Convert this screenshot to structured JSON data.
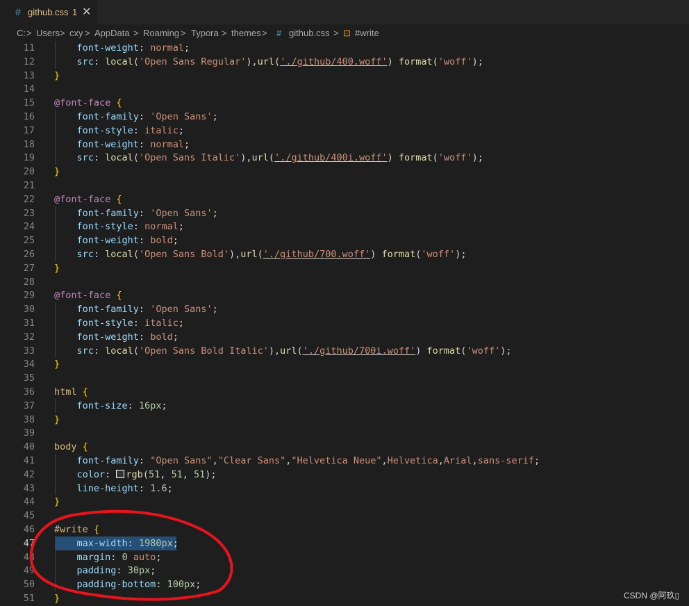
{
  "tab": {
    "hash": "#",
    "name": "github.css",
    "badge": "1",
    "close": "✕"
  },
  "breadcrumb": [
    "C:",
    ">",
    "Users",
    ">",
    "cxy",
    ">",
    "AppData",
    ">",
    "Roaming",
    ">",
    "Typora",
    ">",
    "themes",
    ">",
    "#",
    "github.css",
    ">",
    "⊡",
    "#write"
  ],
  "lines": [
    {
      "n": "11",
      "t": "    font-weight: normal;"
    },
    {
      "n": "12",
      "t": "    src: local('Open Sans Regular'),url('./github/400.woff') format('woff');"
    },
    {
      "n": "13",
      "t": "}"
    },
    {
      "n": "14",
      "t": ""
    },
    {
      "n": "15",
      "t": "@font-face {"
    },
    {
      "n": "16",
      "t": "    font-family: 'Open Sans';"
    },
    {
      "n": "17",
      "t": "    font-style: italic;"
    },
    {
      "n": "18",
      "t": "    font-weight: normal;"
    },
    {
      "n": "19",
      "t": "    src: local('Open Sans Italic'),url('./github/400i.woff') format('woff');"
    },
    {
      "n": "20",
      "t": "}"
    },
    {
      "n": "21",
      "t": ""
    },
    {
      "n": "22",
      "t": "@font-face {"
    },
    {
      "n": "23",
      "t": "    font-family: 'Open Sans';"
    },
    {
      "n": "24",
      "t": "    font-style: normal;"
    },
    {
      "n": "25",
      "t": "    font-weight: bold;"
    },
    {
      "n": "26",
      "t": "    src: local('Open Sans Bold'),url('./github/700.woff') format('woff');"
    },
    {
      "n": "27",
      "t": "}"
    },
    {
      "n": "28",
      "t": ""
    },
    {
      "n": "29",
      "t": "@font-face {"
    },
    {
      "n": "30",
      "t": "    font-family: 'Open Sans';"
    },
    {
      "n": "31",
      "t": "    font-style: italic;"
    },
    {
      "n": "32",
      "t": "    font-weight: bold;"
    },
    {
      "n": "33",
      "t": "    src: local('Open Sans Bold Italic'),url('./github/700i.woff') format('woff');"
    },
    {
      "n": "34",
      "t": "}"
    },
    {
      "n": "35",
      "t": ""
    },
    {
      "n": "36",
      "t": "html {"
    },
    {
      "n": "37",
      "t": "    font-size: 16px;"
    },
    {
      "n": "38",
      "t": "}"
    },
    {
      "n": "39",
      "t": ""
    },
    {
      "n": "40",
      "t": "body {"
    },
    {
      "n": "41",
      "t": "    font-family: \"Open Sans\",\"Clear Sans\",\"Helvetica Neue\",Helvetica,Arial,sans-serif;"
    },
    {
      "n": "42",
      "t": "    color: rgb(51, 51, 51);"
    },
    {
      "n": "43",
      "t": "    line-height: 1.6;"
    },
    {
      "n": "44",
      "t": "}"
    },
    {
      "n": "45",
      "t": ""
    },
    {
      "n": "46",
      "t": "#write {"
    },
    {
      "n": "47",
      "t": "    max-width: 1980px;"
    },
    {
      "n": "48",
      "t": "    margin: 0 auto;"
    },
    {
      "n": "49",
      "t": "    padding: 30px;"
    },
    {
      "n": "50",
      "t": "    padding-bottom: 100px;"
    },
    {
      "n": "51",
      "t": "}"
    }
  ],
  "active_line": "47",
  "watermark": "CSDN @阿玖▯",
  "colors": {
    "background": "#1e1e1e",
    "annotation": "#e8141c",
    "selection": "#264f78"
  }
}
